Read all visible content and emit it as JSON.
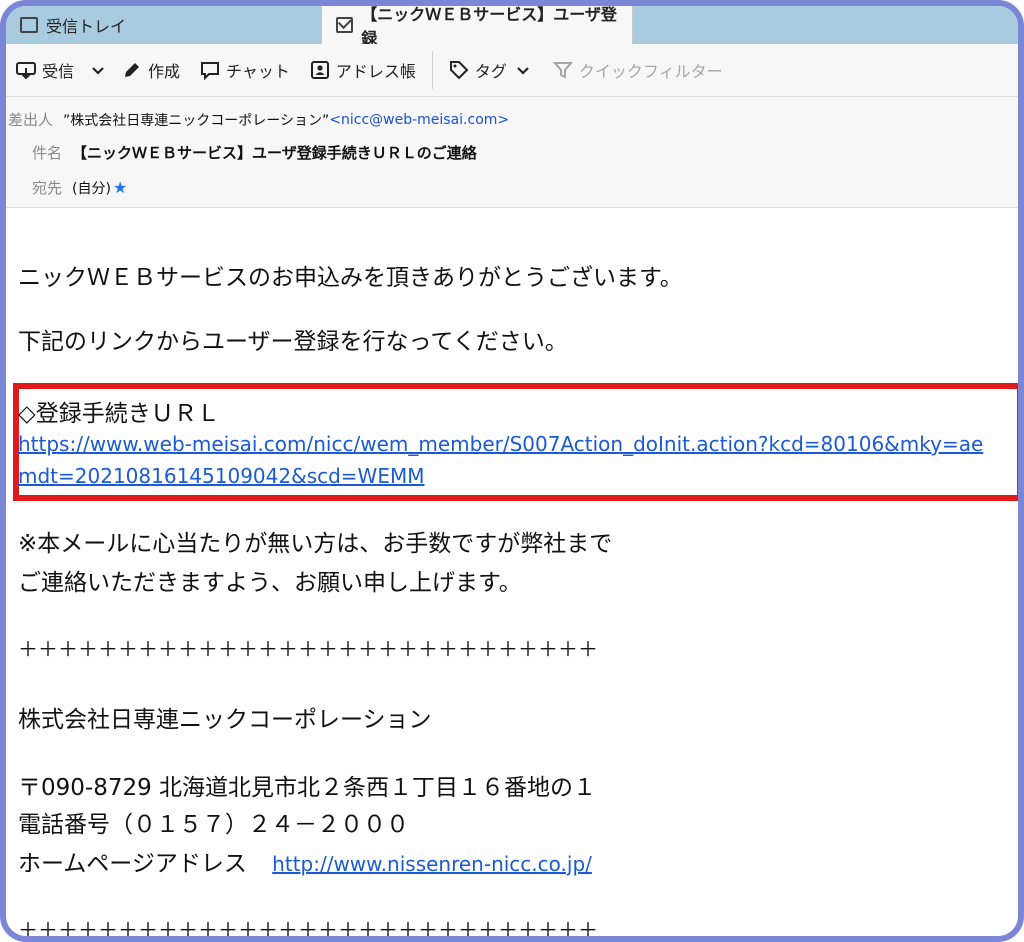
{
  "tabs": {
    "inbox": "受信トレイ",
    "message": "【ニックＷＥＢサービス】ユーザ登録"
  },
  "toolbar": {
    "get_mail": "受信",
    "write": "作成",
    "chat": "チャット",
    "address_book": "アドレス帳",
    "tag": "タグ",
    "quick_filter": "クイックフィルター"
  },
  "header": {
    "from_label": "差出人",
    "from_name": "”株式会社日専連ニックコーポレーション”",
    "from_email": "<nicc@web-meisai.com>",
    "subject_label": "件名",
    "subject": "【ニックＷＥＢサービス】ユーザ登録手続きＵＲＬのご連絡",
    "to_label": "宛先",
    "to_value": "(自分)"
  },
  "body": {
    "line1": "ニックＷＥＢサービスのお申込みを頂きありがとうございます。",
    "line2": "下記のリンクからユーザー登録を行なってください。",
    "url_heading": "◇登録手続きＵＲＬ",
    "url_line1": "https://www.web-meisai.com/nicc/wem_member/S007Action_doInit.action?kcd=80106&mky=ae",
    "url_line2": "mdt=20210816145109042&scd=WEMM",
    "notice1": "※本メールに心当たりが無い方は、お手数ですが弊社まで",
    "notice2": "ご連絡いただきますよう、お願い申し上げます。",
    "separator": "＋＋＋＋＋＋＋＋＋＋＋＋＋＋＋＋＋＋＋＋＋＋＋＋＋＋＋＋＋",
    "company": "株式会社日専連ニックコーポレーション",
    "address": "〒090-8729 北海道北見市北２条西１丁目１６番地の１",
    "phone": "電話番号（０１５７）２４－２０００",
    "homepage_label": "ホームページアドレス",
    "homepage_url": "http://www.nissenren-nicc.co.jp/",
    "separator2": "＋＋＋＋＋＋＋＋＋＋＋＋＋＋＋＋＋＋＋＋＋＋＋＋＋＋＋＋＋"
  },
  "colors": {
    "frame": "#7b86d6",
    "tabbar": "#a9cbe0",
    "link": "#1a5ad6",
    "highlight": "#e11b1b"
  }
}
